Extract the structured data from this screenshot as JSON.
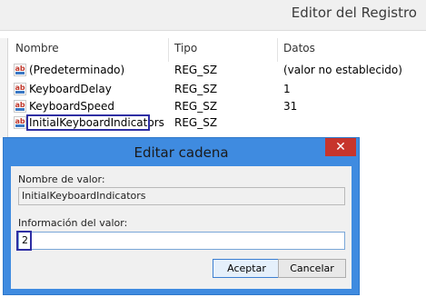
{
  "window": {
    "title": "Editor del Registro"
  },
  "list": {
    "columns": [
      "Nombre",
      "Tipo",
      "Datos"
    ],
    "rows": [
      {
        "name": "(Predeterminado)",
        "type": "REG_SZ",
        "data": "(valor no establecido)"
      },
      {
        "name": "KeyboardDelay",
        "type": "REG_SZ",
        "data": "1"
      },
      {
        "name": "KeyboardSpeed",
        "type": "REG_SZ",
        "data": "31"
      },
      {
        "name": "InitialKeyboardIndicators",
        "type": "REG_SZ",
        "data": ""
      }
    ],
    "row_icon": "string-value-icon"
  },
  "dialog": {
    "title": "Editar cadena",
    "close_glyph": "✕",
    "value_name_label": "Nombre de valor:",
    "value_name": "InitialKeyboardIndicators",
    "value_data_label": "Información del valor:",
    "value_data": "2",
    "ok_label": "Aceptar",
    "cancel_label": "Cancelar"
  },
  "colors": {
    "dialog_frame": "#3f8be0",
    "close_button": "#c7352c",
    "highlight_box": "#2e2ea3"
  }
}
